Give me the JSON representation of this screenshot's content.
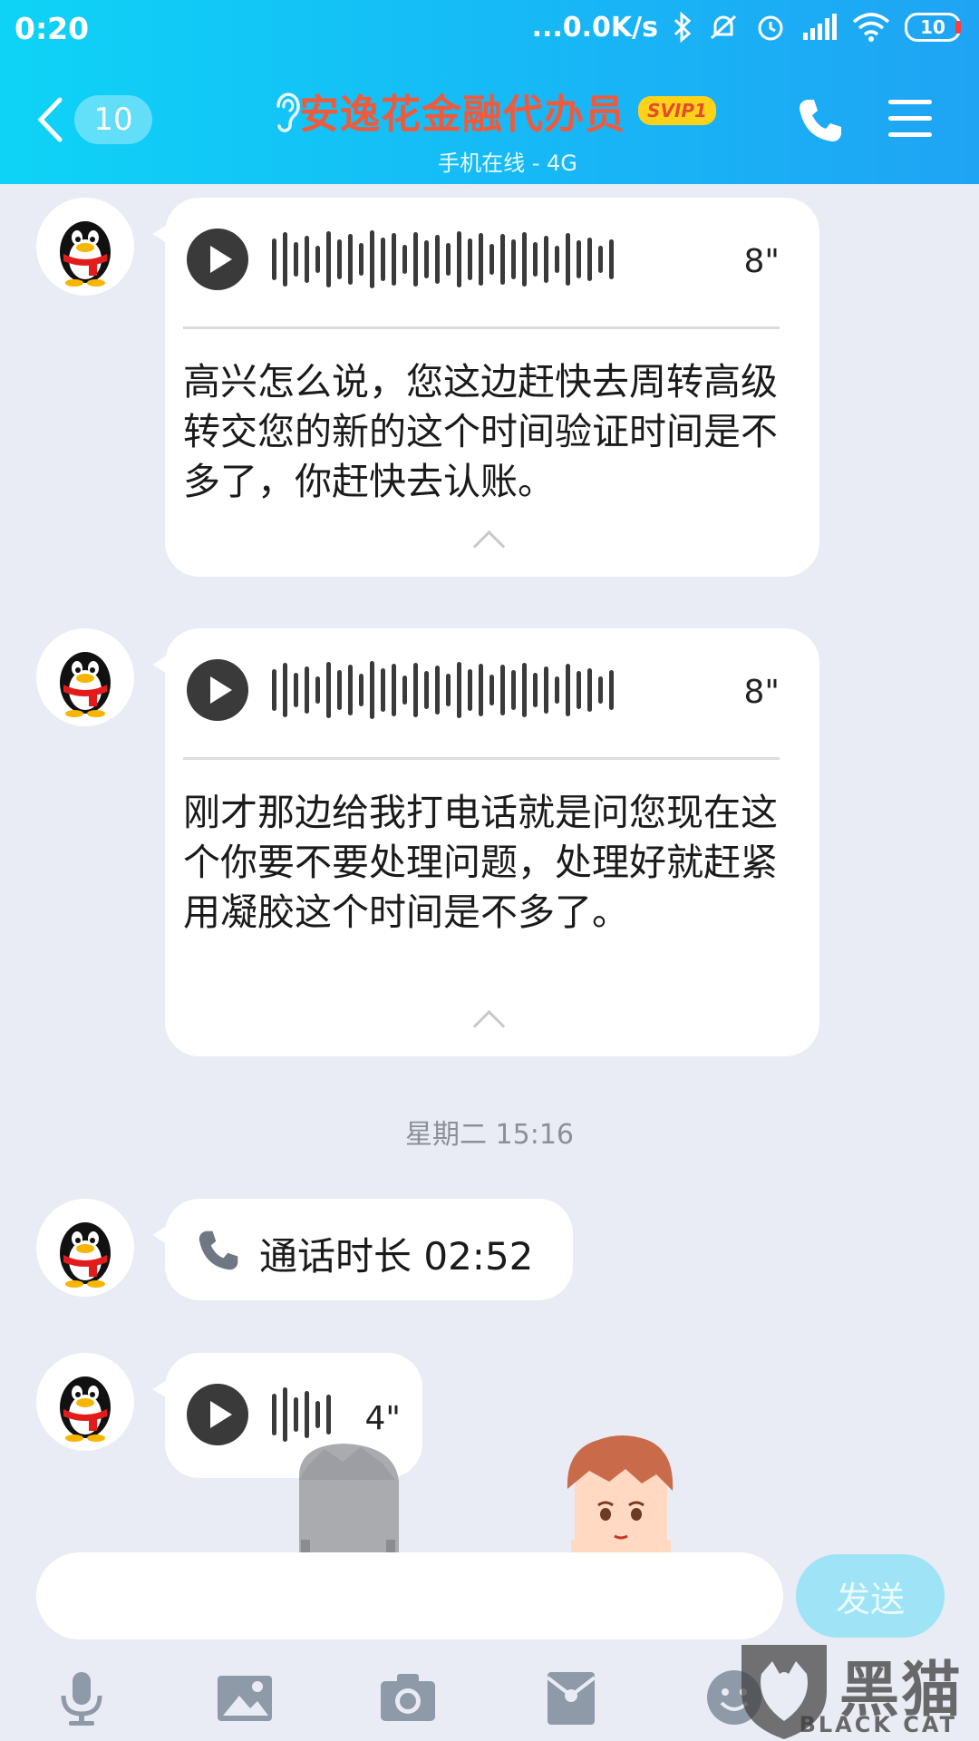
{
  "status_bar": {
    "time": "0:20",
    "network_speed": "...0.0K/s",
    "battery": "10"
  },
  "header": {
    "back_count": "10",
    "title": "安逸花金融代办员",
    "badge": "SVIP1",
    "subtitle": "手机在线 - 4G"
  },
  "messages": [
    {
      "type": "voice",
      "duration": "8\"",
      "transcript": "高兴怎么说，您这边赶快去周转高级转交您的新的这个时间验证时间是不多了，你赶快去认账。"
    },
    {
      "type": "voice",
      "duration": "8\"",
      "transcript": "刚才那边给我打电话就是问您现在这个你要不要处理问题，处理好就赶紧用凝胶这个时间是不多了。"
    },
    {
      "type": "timestamp",
      "text": "星期二 15:16"
    },
    {
      "type": "call",
      "text": "通话时长 02:52"
    },
    {
      "type": "voice",
      "duration": "4\""
    }
  ],
  "input": {
    "placeholder": "",
    "send_label": "发送"
  },
  "toolbar_icons": [
    "microphone-icon",
    "image-icon",
    "camera-icon",
    "red-packet-icon",
    "emoji-icon"
  ],
  "watermark": {
    "text": "黑猫",
    "sub": "BLACK CAT"
  },
  "colors": {
    "header_start": "#0ed3f6",
    "header_end": "#1fa4f4",
    "title": "#ef5a3c",
    "badge_bg": "#ffd21a",
    "chat_bg": "#e9ecf4",
    "send_bg": "#9fe3f7"
  }
}
